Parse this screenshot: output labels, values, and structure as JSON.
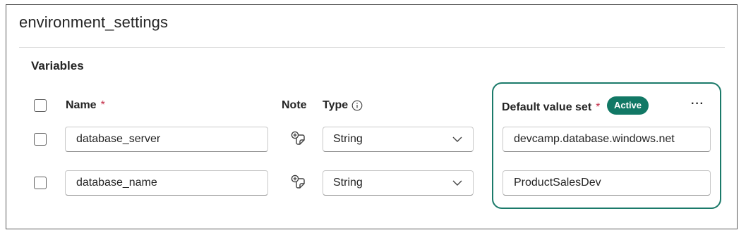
{
  "panel": {
    "title": "environment_settings",
    "section_title": "Variables"
  },
  "table": {
    "headers": {
      "name": "Name",
      "note": "Note",
      "type": "Type",
      "default_value_set": "Default value set",
      "required_mark": "*"
    },
    "active_badge": "Active",
    "more_label": "···",
    "info_icon": "info-icon",
    "note_icon": "note-add-icon",
    "rows": [
      {
        "name": "database_server",
        "type": "String",
        "default_value": "devcamp.database.windows.net",
        "checked": false
      },
      {
        "name": "database_name",
        "type": "String",
        "default_value": "ProductSalesDev",
        "checked": false
      }
    ]
  },
  "colors": {
    "accent": "#117865",
    "highlight_border": "#1b7a6a",
    "required": "#c4314b"
  }
}
